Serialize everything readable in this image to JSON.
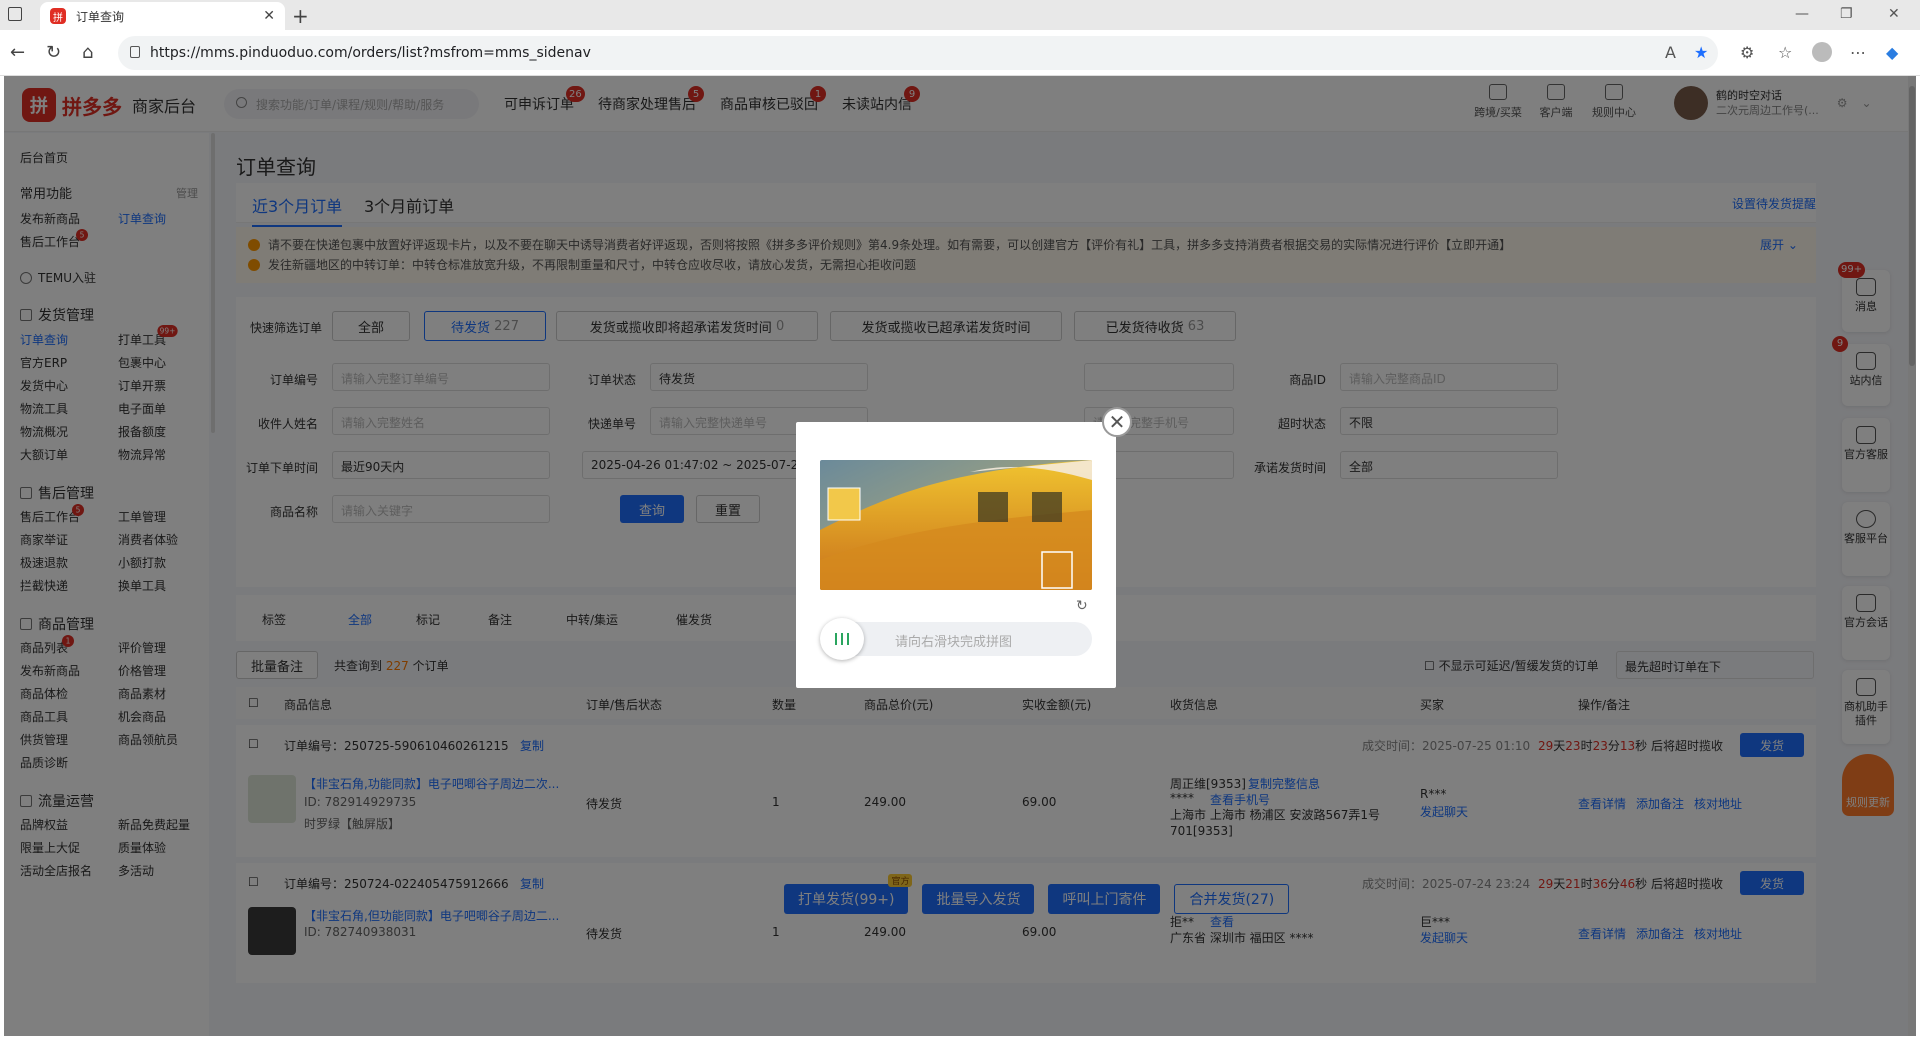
{
  "browser": {
    "tab_title": "订单查询",
    "url": "https://mms.pinduoduo.com/orders/list?msfrom=mms_sidenav"
  },
  "header": {
    "brand": "拼多多",
    "brand_sub": "商家后台",
    "search_placeholder": "搜索功能/订单/课程/规则/帮助/服务",
    "links": [
      {
        "label": "可申诉订单",
        "badge": "26"
      },
      {
        "label": "待商家处理售后",
        "badge": "5"
      },
      {
        "label": "商品审核已驳回",
        "badge": "1"
      },
      {
        "label": "未读站内信",
        "badge": "9"
      }
    ],
    "icons": [
      "跨境/买菜",
      "客户端",
      "规则中心"
    ],
    "user_name": "鹤的时空对话",
    "user_sub": "二次元周边工作号(..."
  },
  "sidebar": {
    "home": "后台首页",
    "common": "常用功能",
    "manage": "管理",
    "common_items": [
      "发布新商品",
      "订单查询",
      "售后工作台"
    ],
    "common_badge": "5",
    "temu": "TEMU入驻",
    "sections": [
      {
        "title": "发货管理",
        "items": [
          "订单查询",
          "打单工具",
          "官方ERP",
          "包裹中心",
          "发货中心",
          "订单开票",
          "物流工具",
          "电子面单",
          "物流概况",
          "报备额度",
          "大额订单",
          "物流异常"
        ],
        "badge": "99+"
      },
      {
        "title": "售后管理",
        "items": [
          "售后工作台",
          "工单管理",
          "商家举证",
          "消费者体验",
          "极速退款",
          "小额打款",
          "拦截快递",
          "换单工具"
        ],
        "badge": "5"
      },
      {
        "title": "商品管理",
        "items": [
          "商品列表",
          "评价管理",
          "发布新商品",
          "价格管理",
          "商品体检",
          "商品素材",
          "商品工具",
          "机会商品",
          "供货管理",
          "商品领航员",
          "品质诊断"
        ],
        "badge": "1"
      },
      {
        "title": "流量运营",
        "items": [
          "品牌权益",
          "新品免费起量",
          "限量上大促",
          "质量体验",
          "活动全店报名",
          "多活动"
        ]
      }
    ]
  },
  "main": {
    "title": "订单查询",
    "tabs": [
      "近3个月订单",
      "3个月前订单"
    ],
    "reminder_link": "设置待发货提醒",
    "notices": [
      "请不要在快递包裹中放置好评返现卡片，以及不要在聊天中诱导消费者好评返现，否则将按照《拼多多评价规则》第4.9条处理。如有需要，可以创建官方【评价有礼】工具，拼多多支持消费者根据交易的实际情况进行评价【立即开通】",
      "发往新疆地区的中转订单：中转仓标准放宽升级，不再限制重量和尺寸，中转仓应收尽收，请放心发货，无需担心拒收问题"
    ],
    "expand": "展开",
    "quick_label": "快速筛选订单",
    "quick_filters": [
      {
        "label": "全部",
        "count": ""
      },
      {
        "label": "待发货",
        "count": "227"
      },
      {
        "label": "发货或揽收即将超承诺发货时间",
        "count": "0"
      },
      {
        "label": "发货或揽收已超承诺发货时间",
        "count": ""
      },
      {
        "label": "已发货待收货",
        "count": "63"
      }
    ],
    "filters": {
      "order_no_label": "订单编号",
      "order_no_ph": "请输入完整订单编号",
      "status_label": "订单状态",
      "status_val": "待发货",
      "goods_id_label": "商品ID",
      "goods_id_ph": "请输入完整商品ID",
      "receiver_label": "收件人姓名",
      "receiver_ph": "请输入完整姓名",
      "express_label": "快递单号",
      "express_ph": "请输入完整快递单号",
      "phone_ph": "请输入完整手机号",
      "timeout_label": "超时状态",
      "timeout_val": "不限",
      "time_label": "订单下单时间",
      "time_val": "最近90天内",
      "range_val": "2025-04-26 01:47:02 ~ 2025-07-25 01:47:02",
      "promise_label": "承诺发货时间",
      "promise_val": "全部",
      "goods_name_label": "商品名称",
      "goods_name_ph": "请输入关键字",
      "query": "查询",
      "reset": "重置"
    },
    "tag_bar": {
      "label": "标签",
      "items": [
        "全部",
        "标记",
        "备注",
        "中转/集运",
        "催发货"
      ]
    },
    "batch_note": "批量备注",
    "total_prefix": "共查询到",
    "total_count": "227",
    "total_suffix": "个订单",
    "hide_delay": "不显示可延迟/暂缓发货的订单",
    "sort_val": "最先超时订单在下",
    "columns": [
      "商品信息",
      "订单/售后状态",
      "数量",
      "商品总价(元)",
      "实收金额(元)",
      "收货信息",
      "买家",
      "操作/备注"
    ],
    "orders": [
      {
        "no": "订单编号：250725-590610460261215",
        "copy": "复制",
        "deal_time": "成交时间：2025-07-25 01:10",
        "timer_d": "29",
        "timer_h": "23",
        "timer_m": "23",
        "timer_s": "13",
        "timer_suffix": "后将超时揽收",
        "ship": "发货",
        "title": "【非宝石角,功能同款】电子吧唧谷子周边二次...",
        "gid": "ID: 782914929735",
        "spec": "时罗绿【触屏版】",
        "status": "待发货",
        "qty": "1",
        "total": "249.00",
        "paid": "69.00",
        "receiver": "周正维[9353]",
        "copy_addr": "复制完整信息",
        "phone": "****",
        "view_phone": "查看手机号",
        "addr": "上海市 上海市 杨浦区 安波路567弄1号701[9353]",
        "buyer": "R***",
        "chat": "发起聊天",
        "ops": [
          "查看详情",
          "添加备注",
          "核对地址"
        ]
      },
      {
        "no": "订单编号：250724-022405475912666",
        "copy": "复制",
        "deal_time": "成交时间：2025-07-24 23:24",
        "timer_d": "29",
        "timer_h": "21",
        "timer_m": "36",
        "timer_s": "46",
        "timer_suffix": "后将超时揽收",
        "ship": "发货",
        "title": "【非宝石角,但功能同款】电子吧唧谷子周边二...",
        "gid": "ID: 782740938031",
        "spec": "",
        "status": "待发货",
        "qty": "1",
        "total": "249.00",
        "paid": "69.00",
        "receiver": "拒**",
        "copy_addr": "查看",
        "phone": "",
        "view_phone": "",
        "addr": "广东省 深圳市 福田区 ****",
        "buyer": "巨***",
        "chat": "发起聊天",
        "ops": [
          "查看详情",
          "添加备注",
          "核对地址"
        ]
      }
    ],
    "bottom_buttons": [
      "打单发货(99+)",
      "批量导入发货",
      "呼叫上门寄件",
      "合并发货(27)"
    ],
    "bottom_tag": "官方"
  },
  "right_float": [
    {
      "label": "消息",
      "badge": "99+"
    },
    {
      "label": "站内信",
      "badge": "9"
    },
    {
      "label": "官方客服"
    },
    {
      "label": "客服平台"
    },
    {
      "label": "官方会话"
    },
    {
      "label": "商机助手插件"
    },
    {
      "label": "规则更新"
    }
  ],
  "captcha": {
    "hint": "请向右滑块完成拼图",
    "progress": 0
  }
}
